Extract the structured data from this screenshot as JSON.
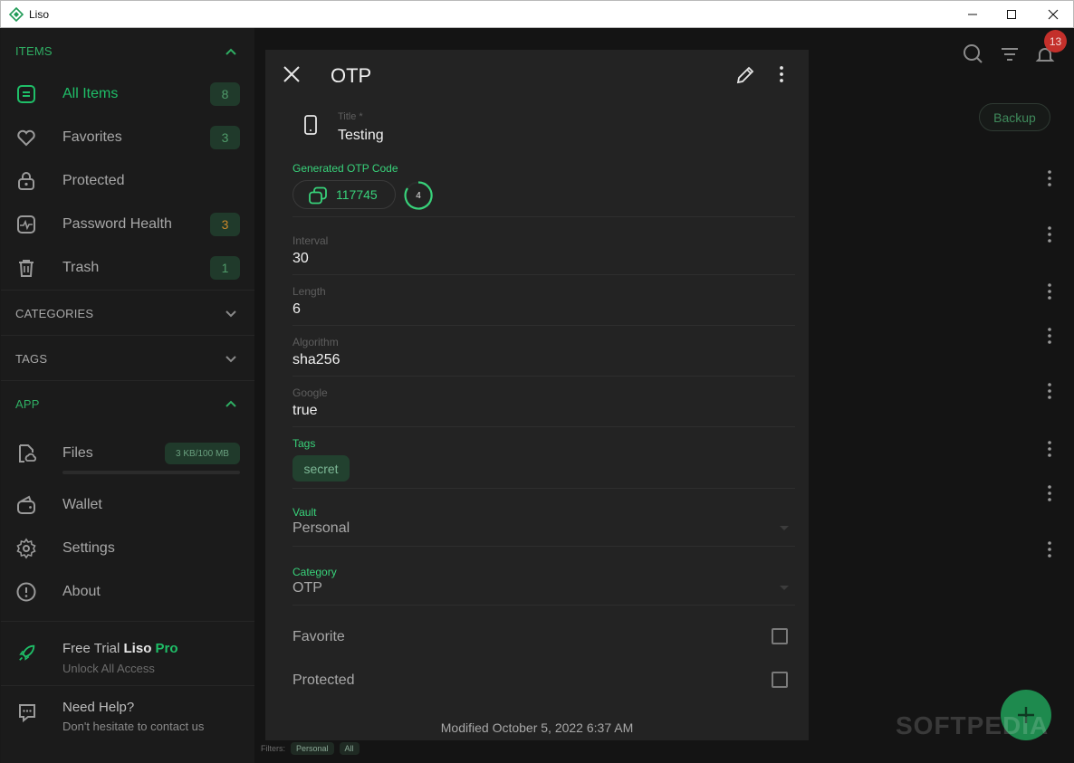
{
  "window": {
    "title": "Liso"
  },
  "sidebar": {
    "items_header": "ITEMS",
    "items": [
      {
        "label": "All Items",
        "badge": "8",
        "icon": "list-icon",
        "active": true
      },
      {
        "label": "Favorites",
        "badge": "3",
        "icon": "heart-icon"
      },
      {
        "label": "Protected",
        "badge": "",
        "icon": "lock-icon"
      },
      {
        "label": "Password Health",
        "badge": "3",
        "icon": "pulse-icon"
      },
      {
        "label": "Trash",
        "badge": "1",
        "icon": "trash-icon"
      }
    ],
    "categories_header": "CATEGORIES",
    "tags_header": "TAGS",
    "app_header": "APP",
    "app_items": [
      {
        "label": "Files",
        "storage": "3 KB/100 MB",
        "icon": "file-cloud-icon"
      },
      {
        "label": "Wallet",
        "icon": "wallet-icon"
      },
      {
        "label": "Settings",
        "icon": "gear-icon"
      },
      {
        "label": "About",
        "icon": "info-icon"
      }
    ],
    "promo": {
      "title_prefix": "Free Trial ",
      "title_brand": "Liso",
      "title_pro": "Pro",
      "subtitle": "Unlock All Access",
      "icon": "rocket-icon"
    },
    "help": {
      "title": "Need Help?",
      "subtitle": "Don't hesitate to contact us",
      "icon": "chat-icon"
    }
  },
  "main": {
    "notification_count": "13",
    "backup_label": "Backup",
    "filters_label": "Filters:",
    "filter_vault": "Personal",
    "filter_all": "All",
    "watermark": "SOFTPEDIA"
  },
  "dialog": {
    "title": "OTP",
    "title_field_label": "Title *",
    "title_field_value": "Testing",
    "otp_label": "Generated OTP Code",
    "otp_code": "117745",
    "otp_timer": "4",
    "fields": [
      {
        "label": "Interval",
        "value": "30"
      },
      {
        "label": "Length",
        "value": "6"
      },
      {
        "label": "Algorithm",
        "value": "sha256"
      },
      {
        "label": "Google",
        "value": "true"
      }
    ],
    "tags_label": "Tags",
    "tag": "secret",
    "vault_label": "Vault",
    "vault_value": "Personal",
    "category_label": "Category",
    "category_value": "OTP",
    "favorite_label": "Favorite",
    "protected_label": "Protected",
    "modified": "Modified October 5, 2022 6:37 AM"
  },
  "colors": {
    "accent": "#38d27a",
    "section_header": "#2fae63",
    "badge_bg": "#203a2b",
    "dialog_bg": "#232323"
  }
}
